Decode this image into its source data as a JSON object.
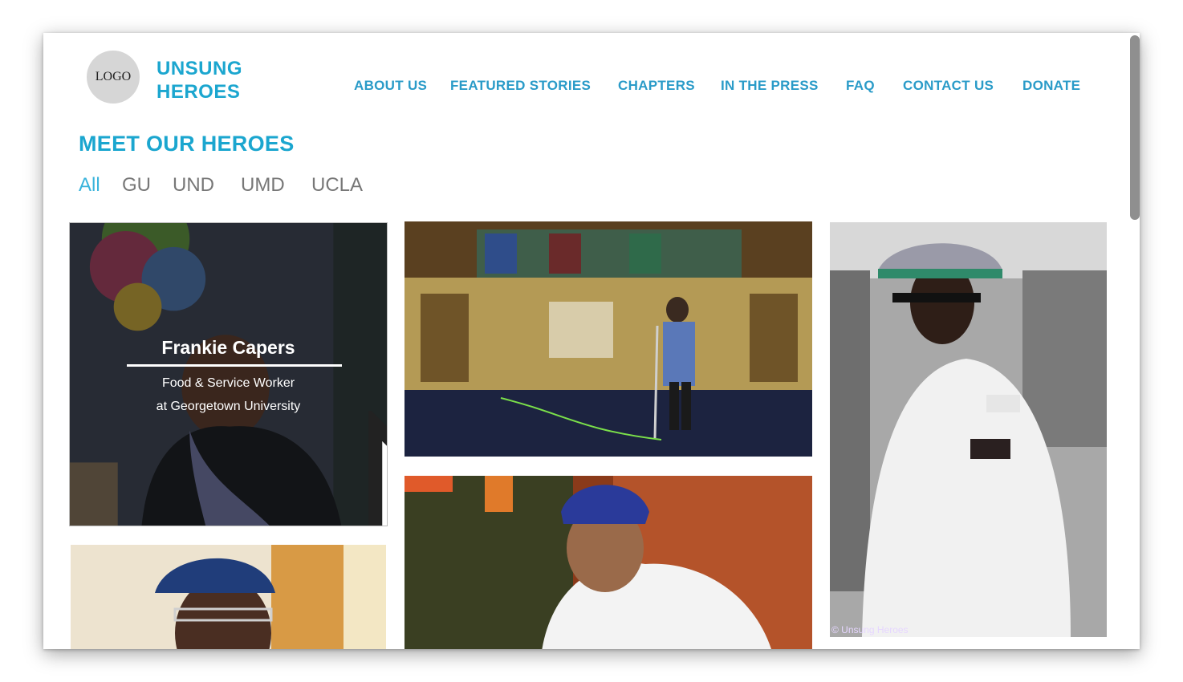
{
  "header": {
    "logo_text": "LOGO",
    "brand_line1": "UNSUNG",
    "brand_line2": "HEROES"
  },
  "nav": {
    "items": [
      {
        "label": "ABOUT US"
      },
      {
        "label": "FEATURED STORIES"
      },
      {
        "label": "CHAPTERS"
      },
      {
        "label": "IN THE PRESS"
      },
      {
        "label": "FAQ"
      },
      {
        "label": "CONTACT US"
      },
      {
        "label": "DONATE"
      }
    ]
  },
  "main": {
    "title": "MEET OUR HEROES",
    "filters": [
      {
        "label": "All",
        "active": true
      },
      {
        "label": "GU",
        "active": false
      },
      {
        "label": "UND",
        "active": false
      },
      {
        "label": "UMD",
        "active": false
      },
      {
        "label": "UCLA",
        "active": false
      }
    ]
  },
  "gallery": {
    "featured": {
      "name": "Frankie Capers",
      "role": "Food & Service Worker",
      "org": "at Georgetown University"
    },
    "watermark": "© Unsung Heroes"
  },
  "colors": {
    "brand": "#1ba6cf",
    "nav": "#2a9bc8",
    "filter_inactive": "#777777",
    "filter_active": "#3bb4dc"
  }
}
